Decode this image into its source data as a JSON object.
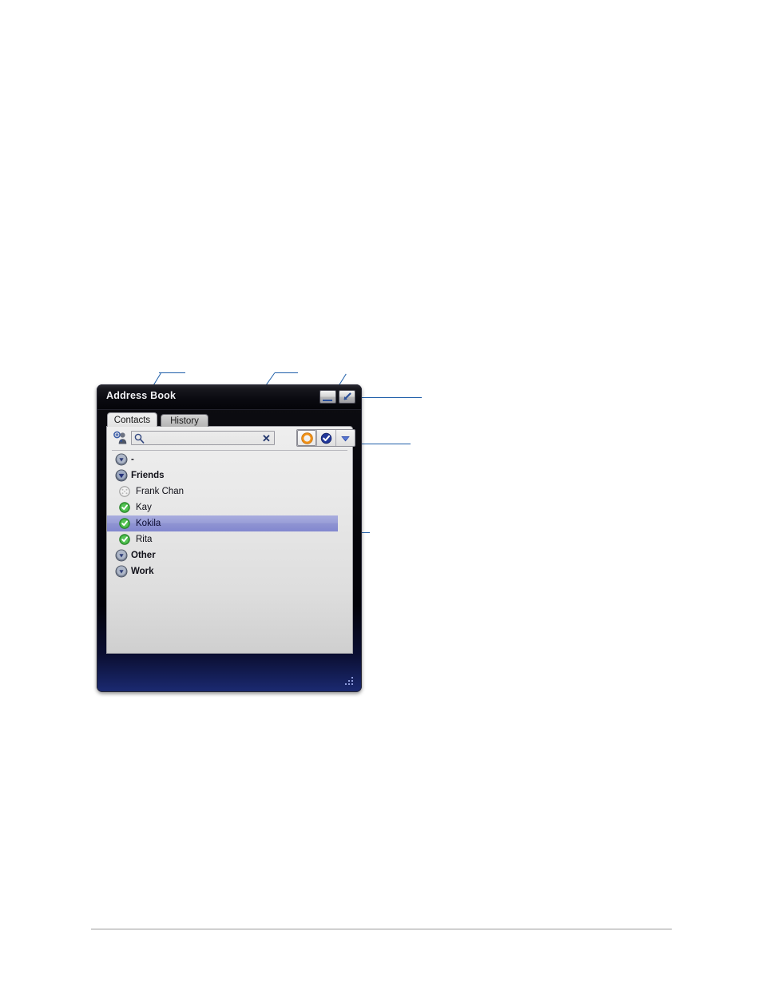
{
  "window": {
    "title": "Address Book",
    "controls": [
      {
        "name": "minimize",
        "icon": "minimize-icon"
      },
      {
        "name": "restore",
        "icon": "restore-icon"
      }
    ],
    "resize_grip": "resize-grip"
  },
  "tabs": [
    {
      "label": "Contacts",
      "active": true
    },
    {
      "label": "History",
      "active": false
    }
  ],
  "toolbar": {
    "add_contact_icon": "add-contact-icon",
    "search": {
      "icon": "search-icon",
      "value": "",
      "placeholder": "",
      "clear_label": "✕"
    },
    "status_buttons": [
      {
        "name": "status-away",
        "icon": "away-ring-icon",
        "selected": true
      },
      {
        "name": "status-available",
        "icon": "available-check-icon",
        "selected": false
      },
      {
        "name": "status-menu",
        "icon": "chevron-down-icon",
        "selected": false
      }
    ]
  },
  "contacts": {
    "rows": [
      {
        "type": "group",
        "label": "-",
        "expanded": false,
        "icon": "disclosure-collapsed-icon"
      },
      {
        "type": "group",
        "label": "Friends",
        "expanded": true,
        "icon": "disclosure-expanded-icon"
      },
      {
        "type": "contact",
        "label": "Frank Chan",
        "status": "offline",
        "icon": "status-offline-icon",
        "selected": false
      },
      {
        "type": "contact",
        "label": "Kay",
        "status": "online",
        "icon": "status-online-icon",
        "selected": false
      },
      {
        "type": "contact",
        "label": "Kokila",
        "status": "online",
        "icon": "status-online-icon",
        "selected": true
      },
      {
        "type": "contact",
        "label": "Rita",
        "status": "online",
        "icon": "status-online-icon",
        "selected": false
      },
      {
        "type": "group",
        "label": "Other",
        "expanded": false,
        "icon": "disclosure-collapsed-icon"
      },
      {
        "type": "group",
        "label": "Work",
        "expanded": false,
        "icon": "disclosure-collapsed-icon"
      }
    ]
  },
  "annotations": {
    "line_color": "#1f5fa9",
    "callouts": [
      {
        "name": "callout-add-contact",
        "target": "add-contact-icon"
      },
      {
        "name": "callout-search-field",
        "target": "search-input"
      },
      {
        "name": "callout-window-controls",
        "target": "window-controls"
      },
      {
        "name": "callout-status-buttons",
        "target": "status-buttons"
      },
      {
        "name": "callout-selected-contact",
        "target": "selected-contact-row"
      }
    ]
  },
  "colors": {
    "titlebar": "#0a0a10",
    "panel": "#e9e9e9",
    "selection": "#9a9fd8",
    "status_online": "#3fae3f",
    "status_away": "#f09016",
    "status_available": "#22389a",
    "disclosure": "#4a5fa8"
  }
}
